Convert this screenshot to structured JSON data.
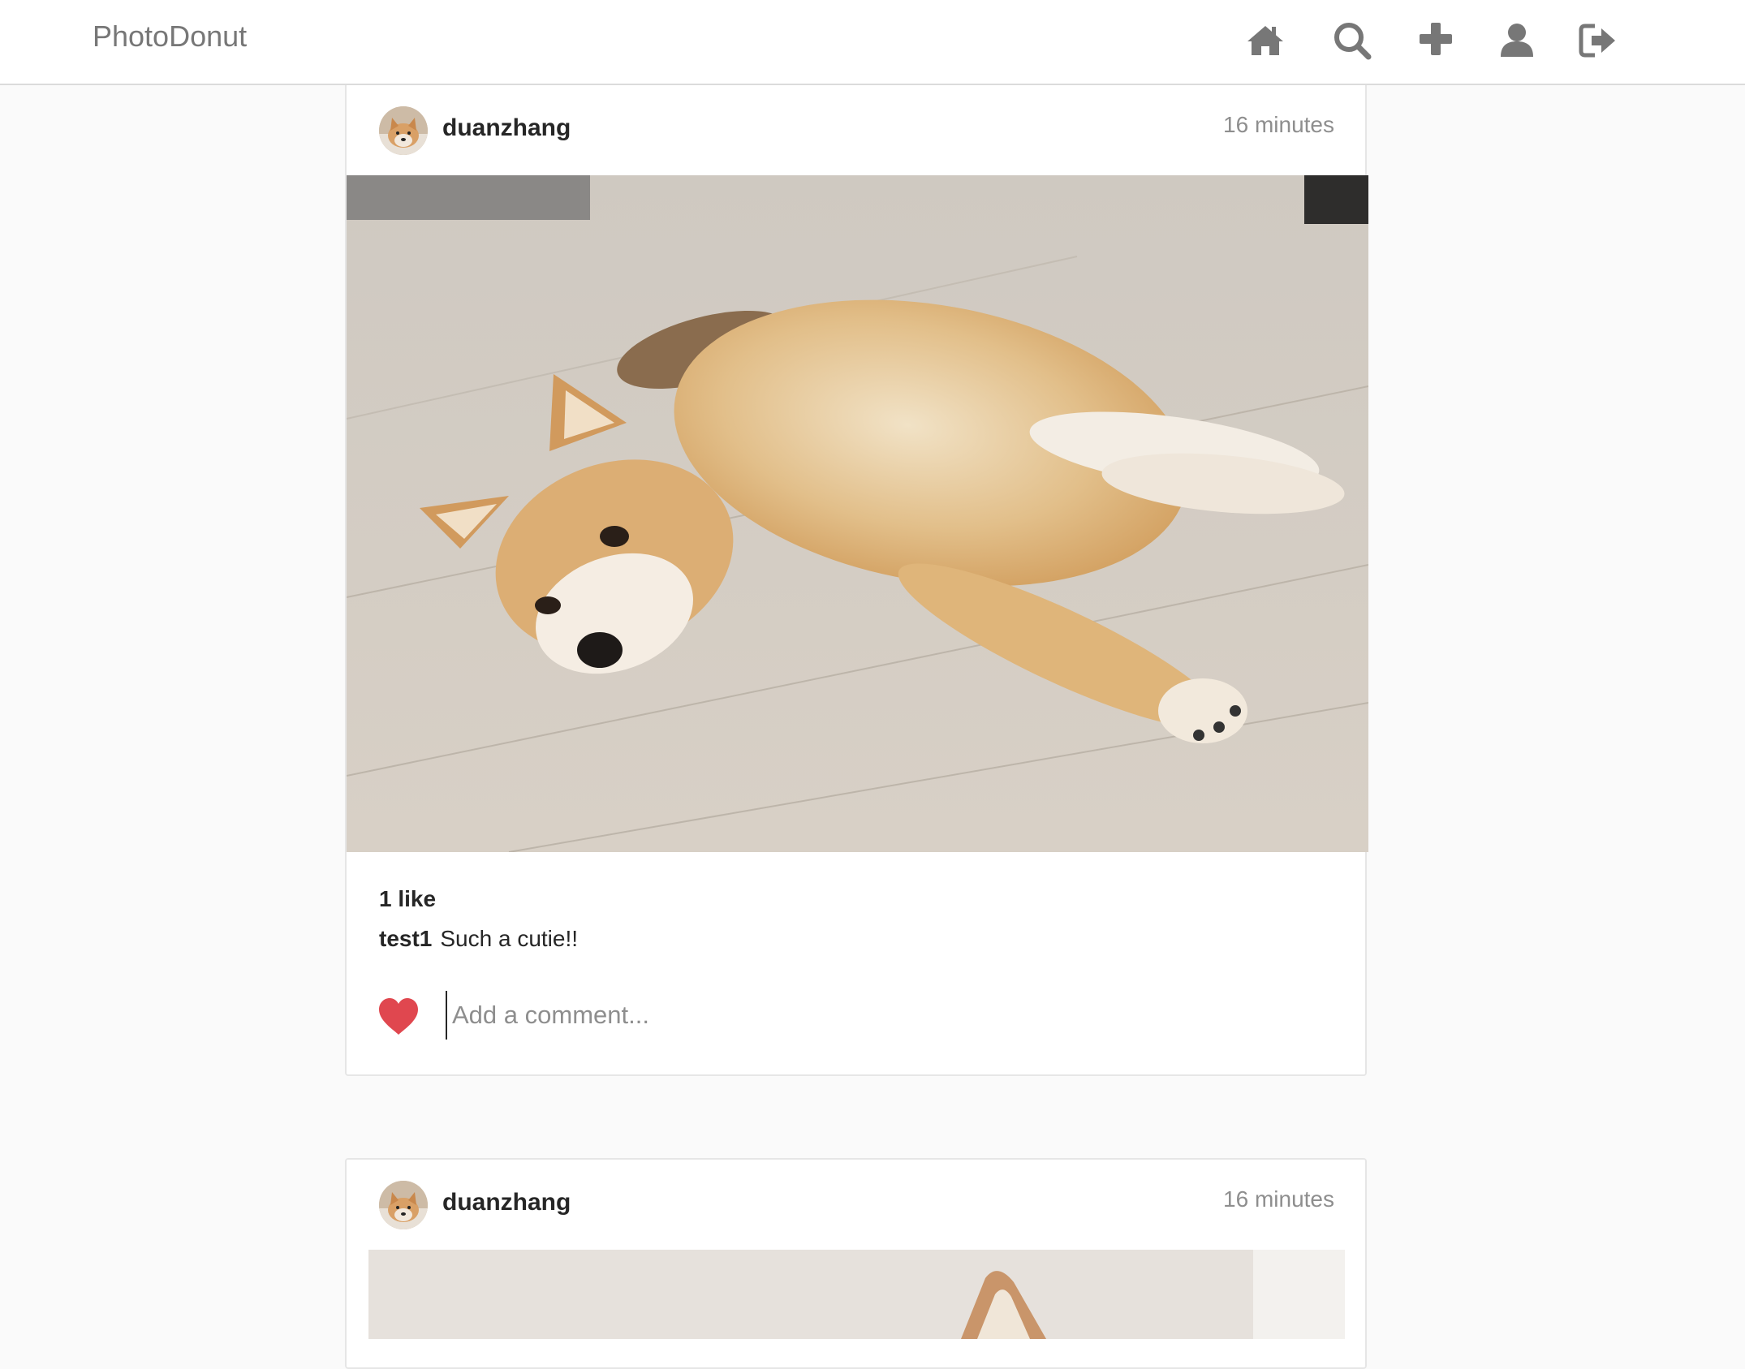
{
  "app": {
    "brand": "PhotoDonut"
  },
  "nav": {
    "icons": [
      "home-icon",
      "search-icon",
      "plus-icon",
      "user-icon",
      "logout-icon"
    ]
  },
  "colors": {
    "like_red": "#e0474f",
    "muted_text": "#8e8e8e",
    "brand_text": "#777777"
  },
  "posts": [
    {
      "username": "duanzhang",
      "time": "16 minutes",
      "likes": "1 like",
      "comments": [
        {
          "user": "test1",
          "text": "Such a cutie!!"
        }
      ],
      "comment_placeholder": "Add a comment..."
    },
    {
      "username": "duanzhang",
      "time": "16 minutes"
    }
  ]
}
